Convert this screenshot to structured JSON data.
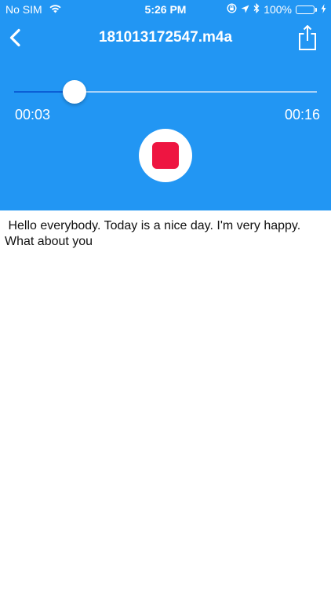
{
  "status_bar": {
    "carrier": "No SIM",
    "time": "5:26 PM",
    "battery": "100%"
  },
  "nav": {
    "title": "181013172547.m4a",
    "back_icon": "chevron-left-icon",
    "share_icon": "share-icon"
  },
  "player": {
    "elapsed": "00:03",
    "total": "00:16",
    "progress": 0.2,
    "stop_icon": "stop-icon"
  },
  "transcript": {
    "text": " Hello everybody. Today is a nice day. I'm very happy. What about you"
  },
  "colors": {
    "header_bg": "#2296f3",
    "stop_red": "#ee1541",
    "battery_green": "#4cd964"
  }
}
